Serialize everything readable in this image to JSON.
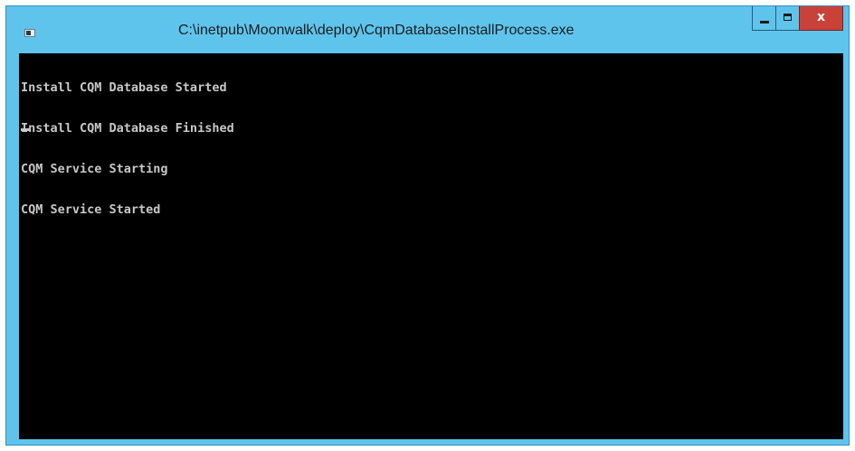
{
  "window": {
    "title": "C:\\inetpub\\Moonwalk\\deploy\\CqmDatabaseInstallProcess.exe",
    "icon": "console-app-icon",
    "controls": {
      "minimize_icon": "minimize-icon",
      "maximize_icon": "maximize-icon",
      "close_label": "x"
    }
  },
  "console": {
    "lines": [
      "Install CQM Database Started",
      "Install CQM Database Finished",
      "CQM Service Starting",
      "CQM Service Started"
    ]
  },
  "colors": {
    "titlebar": "#5ec4ec",
    "close_button": "#c8423a",
    "console_background": "#000000",
    "console_text": "#c7c7c7"
  }
}
